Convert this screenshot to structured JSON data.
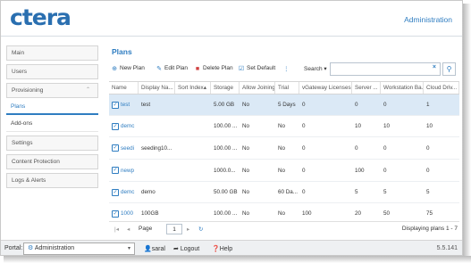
{
  "header": {
    "logo": "ctera",
    "title": "Administration"
  },
  "sidebar": {
    "main": "Main",
    "users": "Users",
    "provisioning": "Provisioning",
    "plans": "Plans",
    "addons": "Add-ons",
    "settings": "Settings",
    "content_protection": "Content Protection",
    "logs_alerts": "Logs & Alerts"
  },
  "main": {
    "title": "Plans",
    "toolbar": {
      "new_plan": "New Plan",
      "edit_plan": "Edit Plan",
      "delete_plan": "Delete Plan",
      "set_default": "Set Default",
      "search_label": "Search",
      "search_value": ""
    },
    "columns": [
      "Name",
      "Display Na...",
      "Sort Index",
      "Storage",
      "Allow Joining",
      "Trial",
      "vGateway Licenses",
      "Server ...",
      "Workstation Ba...",
      "Cloud Driv..."
    ],
    "rows": [
      {
        "name": "test",
        "display": "test",
        "sort": "",
        "storage": "5.00 GB",
        "allow": "No",
        "trial": "5 Days",
        "vgw": "0",
        "server": "0",
        "ws": "0",
        "cloud": "1"
      },
      {
        "name": "demc",
        "display": "",
        "sort": "",
        "storage": "100.00 ...",
        "allow": "No",
        "trial": "No",
        "vgw": "0",
        "server": "10",
        "ws": "10",
        "cloud": "10"
      },
      {
        "name": "seedi",
        "display": "seeding10...",
        "sort": "",
        "storage": "100.00 ...",
        "allow": "No",
        "trial": "No",
        "vgw": "0",
        "server": "0",
        "ws": "0",
        "cloud": "0"
      },
      {
        "name": "newp",
        "display": "",
        "sort": "",
        "storage": "1000.0...",
        "allow": "No",
        "trial": "No",
        "vgw": "0",
        "server": "100",
        "ws": "0",
        "cloud": "0"
      },
      {
        "name": "demc",
        "display": "demo",
        "sort": "",
        "storage": "50.00 GB",
        "allow": "No",
        "trial": "60 Da...",
        "vgw": "0",
        "server": "5",
        "ws": "5",
        "cloud": "5"
      },
      {
        "name": "1000",
        "display": "100GB",
        "sort": "",
        "storage": "100.00 ...",
        "allow": "No",
        "trial": "No",
        "vgw": "100",
        "server": "20",
        "ws": "50",
        "cloud": "75"
      }
    ],
    "pager": {
      "page_label": "Page",
      "page": "1",
      "of": "of 1",
      "display": "Displaying plans 1 - 7"
    }
  },
  "footer": {
    "portal_label": "Portal:",
    "portal_value": "Administration",
    "user": "saral",
    "logout": "Logout",
    "help": "Help",
    "version": "5.5.141"
  },
  "colors": {
    "accent": "#2f7dc1",
    "selected_row": "#dbe9f6"
  }
}
